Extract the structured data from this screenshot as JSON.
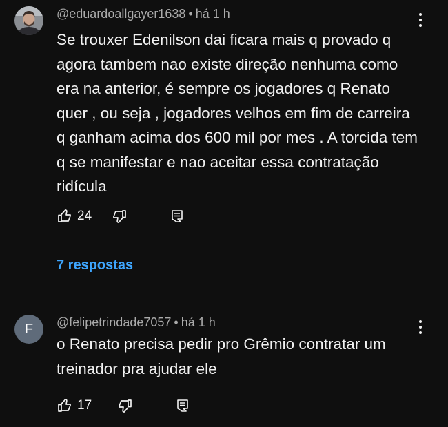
{
  "comments": [
    {
      "author": "@eduardoallgayer1638",
      "separator": "•",
      "time": "há 1 h",
      "text": "Se trouxer Edenilson dai ficara mais q provado q agora tambem nao existe direção nenhuma como era na anterior, é sempre os jogadores q Renato quer , ou seja , jogadores velhos em fim de carreira  q ganham acima dos 600 mil por mes . A torcida tem q se manifestar e nao aceitar essa contratação ridícula",
      "likes": "24",
      "replies_label": "7 respostas",
      "avatar": "user-photo"
    },
    {
      "author": "@felipetrindade7057",
      "separator": "•",
      "time": "há 1 h",
      "text": "o Renato precisa pedir pro Grêmio contratar um treinador pra ajudar ele",
      "likes": "17",
      "avatar_letter": "F"
    }
  ],
  "icons": {
    "like": "thumbs-up-icon",
    "dislike": "thumbs-down-icon",
    "reply": "reply-icon",
    "more": "more-vert-icon"
  },
  "colors": {
    "background": "#0f0f0f",
    "text": "#f1f1f1",
    "meta": "#aaaaaa",
    "link": "#3ea6ff",
    "avatar_letter_bg": "#5f6b7a"
  }
}
